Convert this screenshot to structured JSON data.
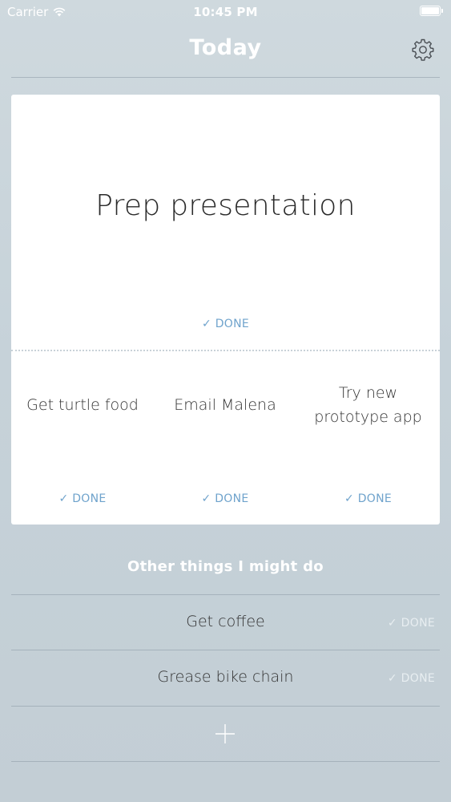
{
  "status_bar": {
    "carrier": "Carrier",
    "time": "10:45 PM",
    "wifi_icon": "wifi-icon",
    "battery_icon": "battery-icon"
  },
  "header": {
    "title": "Today",
    "settings_icon": "gear-icon"
  },
  "today": {
    "main_task": {
      "label": "Prep presentation",
      "done_label": "✓ DONE"
    },
    "sub_tasks": [
      {
        "label": "Get turtle food",
        "done_label": "✓ DONE"
      },
      {
        "label": "Email Malena",
        "done_label": "✓ DONE"
      },
      {
        "label": "Try new prototype app",
        "done_label": "✓ DONE"
      }
    ]
  },
  "other": {
    "title": "Other things I might do",
    "items": [
      {
        "label": "Get coffee",
        "done_label": "✓ DONE"
      },
      {
        "label": "Grease bike chain",
        "done_label": "✓ DONE"
      }
    ],
    "add_icon": "plus-icon"
  },
  "colors": {
    "accent": "#6fa3cc",
    "background": "#c6d2d9",
    "card": "#ffffff"
  }
}
